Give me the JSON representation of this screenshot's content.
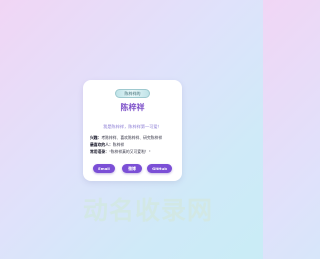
{
  "card": {
    "logo_text": "陈梓祥的",
    "name": "陈梓祥",
    "tagline": "我是陈梓祥，陈梓祥第一可爱！",
    "info": [
      {
        "label": "兴趣：",
        "value": "考陈梓祥、喜欢陈梓祥、研究陈梓祥"
      },
      {
        "label": "最喜欢的人：",
        "value": "陈梓祥"
      },
      {
        "label": "常用语录：",
        "value": "\"陈梓祥真的又可爱啦！\""
      }
    ],
    "buttons": {
      "email": "Email",
      "wechat": "微博",
      "github": "GitHub"
    }
  },
  "watermark": "动名收录网",
  "colors": {
    "accent": "#7b4fd6",
    "name": "#7e52c9",
    "tagline": "#8a7bd4"
  }
}
